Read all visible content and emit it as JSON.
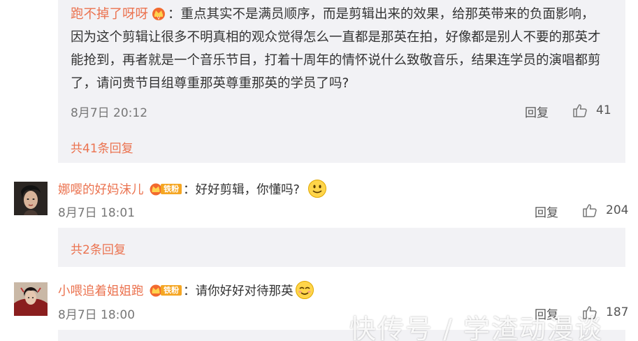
{
  "reply": {
    "username": "跑不掉了呀呀",
    "text": "：重点其实不是满员顺序，而是剪辑出来的效果，给那英带来的负面影响，因为这个剪辑让很多不明真相的观众觉得怎么一直都是那英在拍，好像都是别人不要的那英才能抢到，再者就是一个音乐节目，打着十周年的情怀说什么致敬音乐，结果连学员的演唱都剪了，请问贵节目组尊重那英尊重那英的学员了吗?",
    "lines": [
      "因为这个剪辑让很多不明真相的观众觉得怎么一直都是那英在拍，好像都是别人不要的那英才",
      "能抢到，再者就是一个音乐节目，打着十周年的情怀说什么致敬音乐，结果连学员的演唱都剪",
      "了，请问贵节目组尊重那英尊重那英的学员了吗?"
    ],
    "first_line": "：重点其实不是满员顺序，而是剪辑出来的效果，给那英带来的负面影响，",
    "time": "8月7日 20:12",
    "reply_label": "回复",
    "likes": "41",
    "more_replies": "共41条回复"
  },
  "comments": [
    {
      "username": "娜嘤的好妈沫儿",
      "badge": "铁粉",
      "text": "：好好剪辑，你懂吗?",
      "emoji": "smile-face",
      "time": "8月7日 18:01",
      "reply_label": "回复",
      "likes": "204",
      "more_replies": "共2条回复"
    },
    {
      "username": "小喂追着姐姐跑",
      "badge": "铁粉",
      "text": "：请你好好对待那英",
      "emoji": "smile-face",
      "time": "8月7日 18:00",
      "reply_label": "回复",
      "likes": "187"
    }
  ],
  "watermark": "快传号 / 学渣动漫谈",
  "colors": {
    "username": "#eb7350",
    "reply_bg": "#f2f2f5",
    "badge": "#f5a623"
  }
}
